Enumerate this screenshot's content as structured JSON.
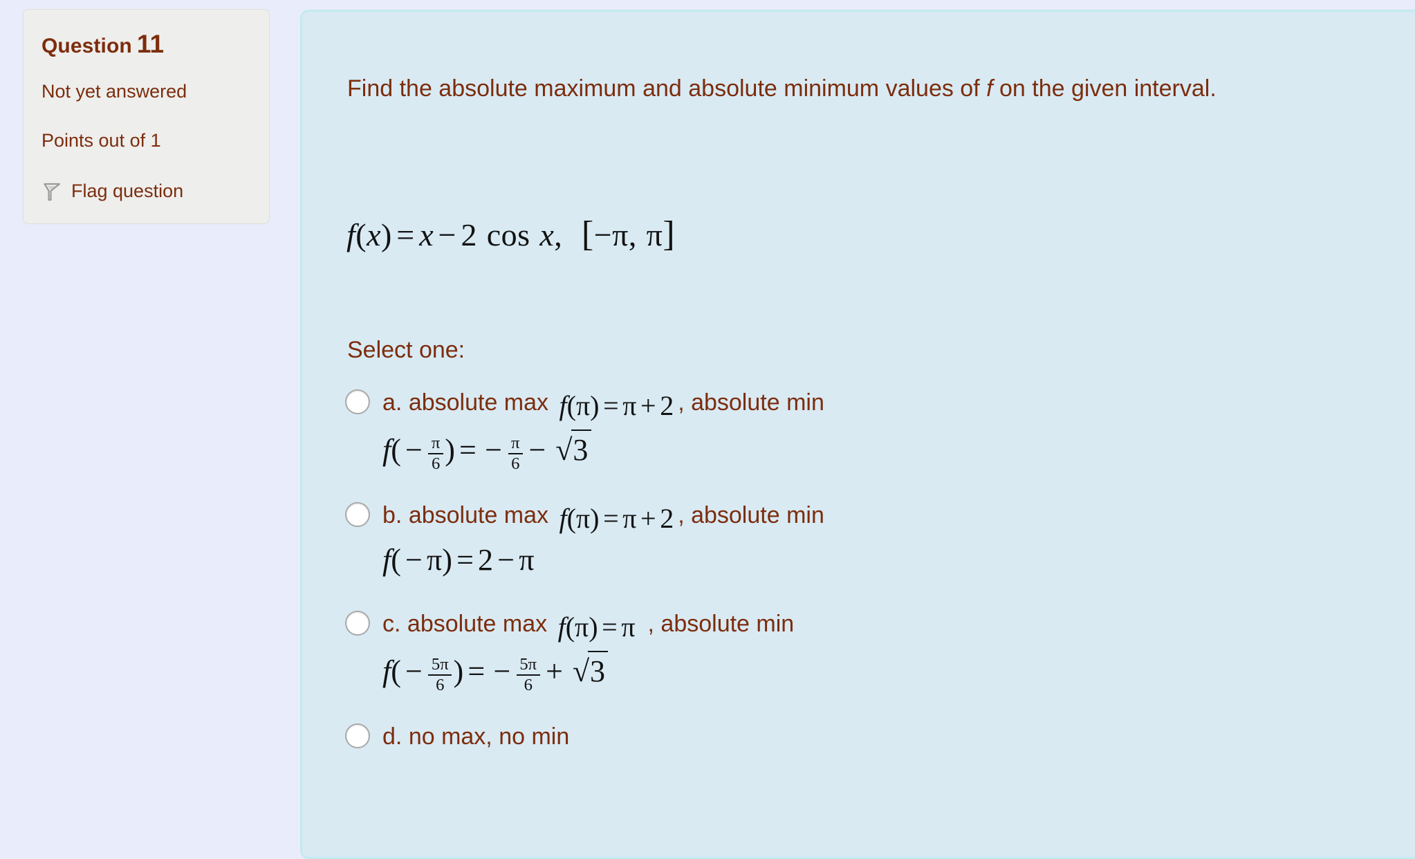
{
  "colors": {
    "page_background": "#e9ecfa",
    "info_box_background": "#eeeeec",
    "content_panel_background": "#d9eaf3",
    "content_panel_border": "#c3eaf0",
    "text": "#7c2d0d",
    "math_text": "#121212"
  },
  "question_info": {
    "heading_label": "Question",
    "number": "11",
    "state": "Not yet answered",
    "grade": "Points out of 1",
    "flag_label": "Flag question",
    "flag_icon": "flag-icon"
  },
  "question": {
    "prompt_part1": "Find the absolute maximum and absolute minimum values of ",
    "prompt_variable": "f",
    "prompt_part2": " on the given interval.",
    "formula": {
      "fn": "f",
      "arg": "x",
      "equals": "=",
      "rhs_var": "x",
      "minus": "−",
      "coefficient": "2",
      "trig": "cos",
      "trig_arg": "x",
      "comma": ",",
      "interval_open": "[",
      "interval_lower": "−π",
      "interval_sep": ",",
      "interval_upper": "π",
      "interval_close": "]",
      "plain": "f(x) = x − 2 cos x,  [−π, π]"
    }
  },
  "select_one_label": "Select one:",
  "answers": [
    {
      "key": "a.",
      "lead_text": "absolute max",
      "math_inline": "f(π) = π + 2",
      "mid_text": ", absolute min",
      "math_block": "f(−π/6) = −π/6 − √3",
      "m1_fn": "f",
      "m1_arg": "π",
      "m1_eq": "=",
      "m1_rhs_a": "π",
      "m1_plus": "+",
      "m1_rhs_b": "2",
      "m2_fn": "f",
      "m2_sign": "−",
      "m2_num": "π",
      "m2_den": "6",
      "m2_eq": "=",
      "m2_rsign": "−",
      "m2_rnum": "π",
      "m2_rden": "6",
      "m2_op": "−",
      "m2_radicand": "3",
      "selected": false
    },
    {
      "key": "b.",
      "lead_text": "absolute max",
      "math_inline": "f(π) = π + 2",
      "mid_text": ", absolute min",
      "math_block": "f(−π) = 2 − π",
      "m1_fn": "f",
      "m1_arg": "π",
      "m1_eq": "=",
      "m1_rhs_a": "π",
      "m1_plus": "+",
      "m1_rhs_b": "2",
      "m2_fn": "f",
      "m2_sign": "−",
      "m2_arg": "π",
      "m2_eq": "=",
      "m2_rhs_a": "2",
      "m2_op": "−",
      "m2_rhs_b": "π",
      "selected": false
    },
    {
      "key": "c.",
      "lead_text": "absolute max",
      "math_inline": "f(π) = π",
      "mid_text": ", absolute min",
      "math_block": "f(−5π/6) = −5π/6 + √3",
      "m1_fn": "f",
      "m1_arg": "π",
      "m1_eq": "=",
      "m1_rhs_a": "π",
      "m2_fn": "f",
      "m2_sign": "−",
      "m2_num": "5π",
      "m2_den": "6",
      "m2_eq": "=",
      "m2_rsign": "−",
      "m2_rnum": "5π",
      "m2_rden": "6",
      "m2_op": "+",
      "m2_radicand": "3",
      "selected": false
    },
    {
      "key": "d.",
      "lead_text": "no max, no min",
      "selected": false
    }
  ]
}
